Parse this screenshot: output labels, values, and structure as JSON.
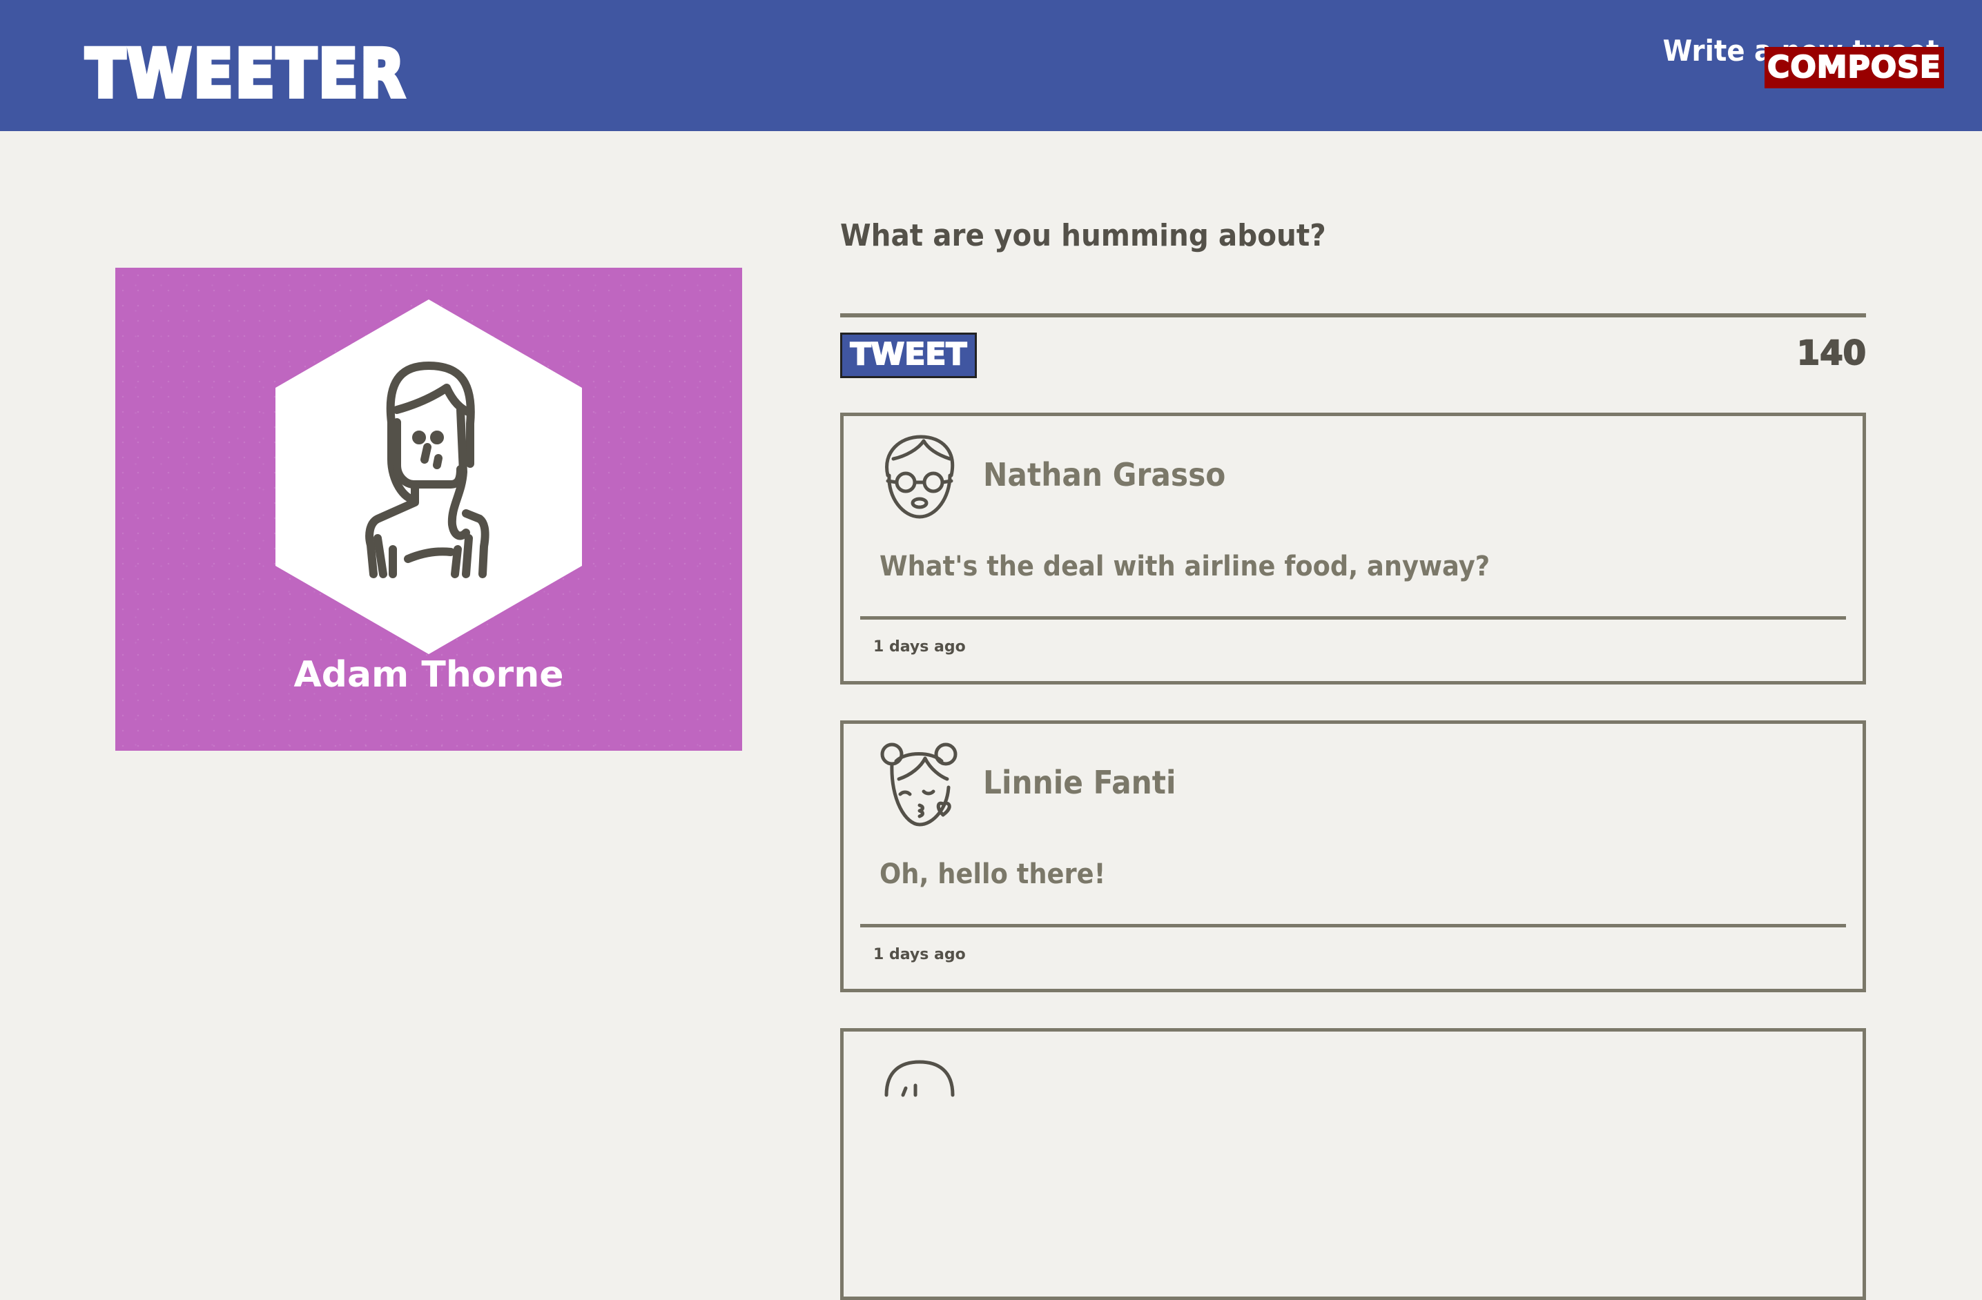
{
  "header": {
    "brand": "TWEETER",
    "compose_title": "Write a new tweet",
    "compose_button": "COMPOSE",
    "color": "#4056a1",
    "compose_color": "#990000"
  },
  "profile": {
    "name": "Adam Thorne",
    "avatar_icon": "woman-avatar-icon",
    "background_color": "#bf66c0"
  },
  "composer": {
    "prompt": "What are you humming about?",
    "tweet_button": "TWEET",
    "counter": "140"
  },
  "tweets": [
    {
      "author": "Nathan Grasso",
      "avatar_icon": "man-glasses-avatar-icon",
      "text": "What's the deal with airline food, anyway?",
      "time": "1 days ago"
    },
    {
      "author": "Linnie Fanti",
      "avatar_icon": "girl-kiss-avatar-icon",
      "text": "Oh, hello there!",
      "time": "1 days ago"
    }
  ]
}
